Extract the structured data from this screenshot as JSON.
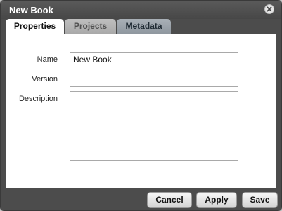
{
  "dialog": {
    "title": "New Book"
  },
  "tabs": [
    {
      "label": "Properties",
      "active": true
    },
    {
      "label": "Projects",
      "active": false
    },
    {
      "label": "Metadata",
      "active": false
    }
  ],
  "form": {
    "name": {
      "label": "Name",
      "value": "New Book"
    },
    "version": {
      "label": "Version",
      "value": ""
    },
    "description": {
      "label": "Description",
      "value": ""
    }
  },
  "buttons": {
    "cancel": "Cancel",
    "apply": "Apply",
    "save": "Save"
  },
  "icons": {
    "close": "close-icon"
  }
}
